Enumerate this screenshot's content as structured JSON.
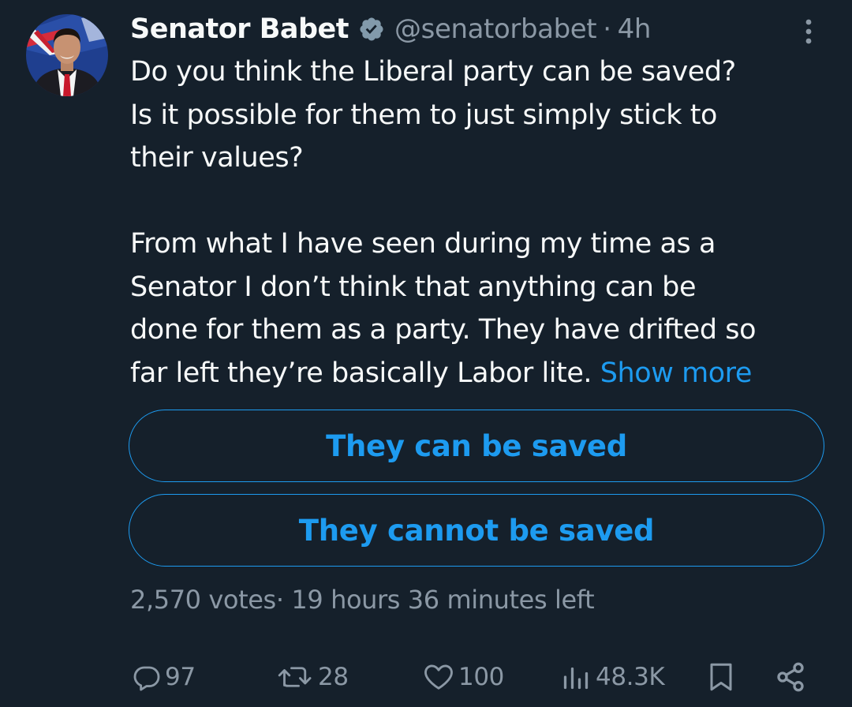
{
  "tweet": {
    "author": {
      "display_name": "Senator Babet",
      "handle": "@senatorbabet",
      "verified": true,
      "avatar_icon": "profile-photo-avatar"
    },
    "separator": "·",
    "time": "4h",
    "text_lines_1": [
      "Do you think the Liberal party can be saved?",
      "Is it possible for them to just simply stick to",
      "their values?"
    ],
    "text_lines_2": [
      "From what I have seen during my time as a",
      "Senator I don’t think that anything can be",
      "done for them as a party. They have drifted so"
    ],
    "last_line": "far left they’re basically Labor lite.",
    "show_more": "Show more",
    "poll": {
      "options": [
        {
          "label": "They can be saved"
        },
        {
          "label": "They cannot be saved"
        }
      ],
      "votes": "2,570 votes",
      "meta_separator": "·",
      "time_left": "19 hours 36 minutes left"
    },
    "actions": {
      "replies": "97",
      "retweets": "28",
      "likes": "100",
      "views": "48.3K"
    }
  },
  "icons": {
    "more": "more-vertical-icon",
    "verified": "verified-badge-icon",
    "reply": "reply-icon",
    "retweet": "retweet-icon",
    "like": "heart-icon",
    "views": "views-bar-chart-icon",
    "bookmark": "bookmark-icon",
    "share": "share-icon"
  },
  "colors": {
    "background": "#15202b",
    "text": "#f7f9f9",
    "muted": "#8b98a5",
    "accent": "#1d9bf0"
  }
}
